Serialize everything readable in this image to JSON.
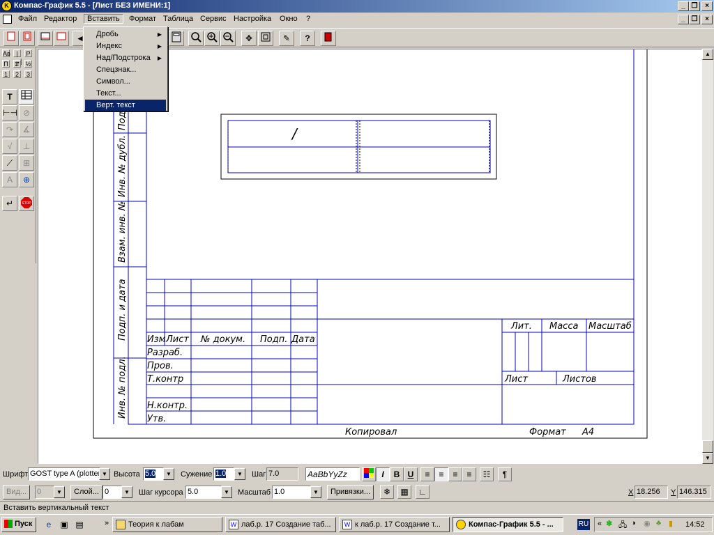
{
  "window": {
    "title": "Компас-График 5.5 - [Лист БЕЗ ИМЕНИ:1]"
  },
  "menu": {
    "items": [
      "Файл",
      "Редактор",
      "Вставить",
      "Формат",
      "Таблица",
      "Сервис",
      "Настройка",
      "Окно",
      "?"
    ]
  },
  "insert_menu": {
    "items": [
      "Дробь",
      "Индекс",
      "Над/Подстрока",
      "Спецзнак...",
      "Символ...",
      "Текст...",
      "Верт. текст"
    ]
  },
  "left_panel": {
    "small": [
      "Ав",
      "|↔|",
      "Р",
      "П",
      "⇵",
      "½",
      "1",
      "2",
      "3"
    ]
  },
  "drawing": {
    "table_cell_text": "/",
    "side_stamp": [
      "Инв. № подл.",
      "Подп. и дата",
      "Взам. инв. №",
      "Инв. № дубл.",
      "Подп. и дата"
    ],
    "title_block": {
      "header": [
        "Изм",
        "Лист",
        "№ докум.",
        "Подп.",
        "Дата"
      ],
      "rows": [
        "Разраб.",
        "Пров.",
        "Т.контр",
        "Н.контр.",
        "Утв."
      ],
      "lit": "Лит.",
      "mass": "Масса",
      "scale": "Масштаб",
      "sheet": "Лист",
      "sheets": "Листов"
    },
    "copied": "Копировал",
    "format": "Формат",
    "format_value": "А4"
  },
  "props": {
    "font_label": "Шрифт",
    "font_value": "GOST type A (plotter)",
    "height_label": "Высота",
    "height_value": "5.0",
    "narrow_label": "Сужение",
    "narrow_value": "1.0",
    "step_label": "Шаг",
    "step_value": "7.0",
    "sample": "AaBbYyZz",
    "bold": "B",
    "italic": "I",
    "underline": "U"
  },
  "bar2": {
    "view_label": "Вид...",
    "view_value": "0",
    "layer_label": "Слой...",
    "layer_value": "0",
    "cursor_label": "Шаг курсора",
    "cursor_value": "5.0",
    "scale_label": "Масштаб",
    "scale_value": "1.0",
    "snaps": "Привязки...",
    "x_label": "X",
    "x_value": "18.256",
    "y_label": "Y",
    "y_value": "146.315"
  },
  "status": {
    "text": "Вставить вертикальный текст"
  },
  "taskbar": {
    "start": "Пуск",
    "tasks": [
      "Теория к лабам",
      "лаб.р. 17 Создание таб...",
      "к лаб.р. 17 Создание т...",
      "Компас-График 5.5 - ..."
    ],
    "lang": "RU",
    "clock": "14:52"
  }
}
